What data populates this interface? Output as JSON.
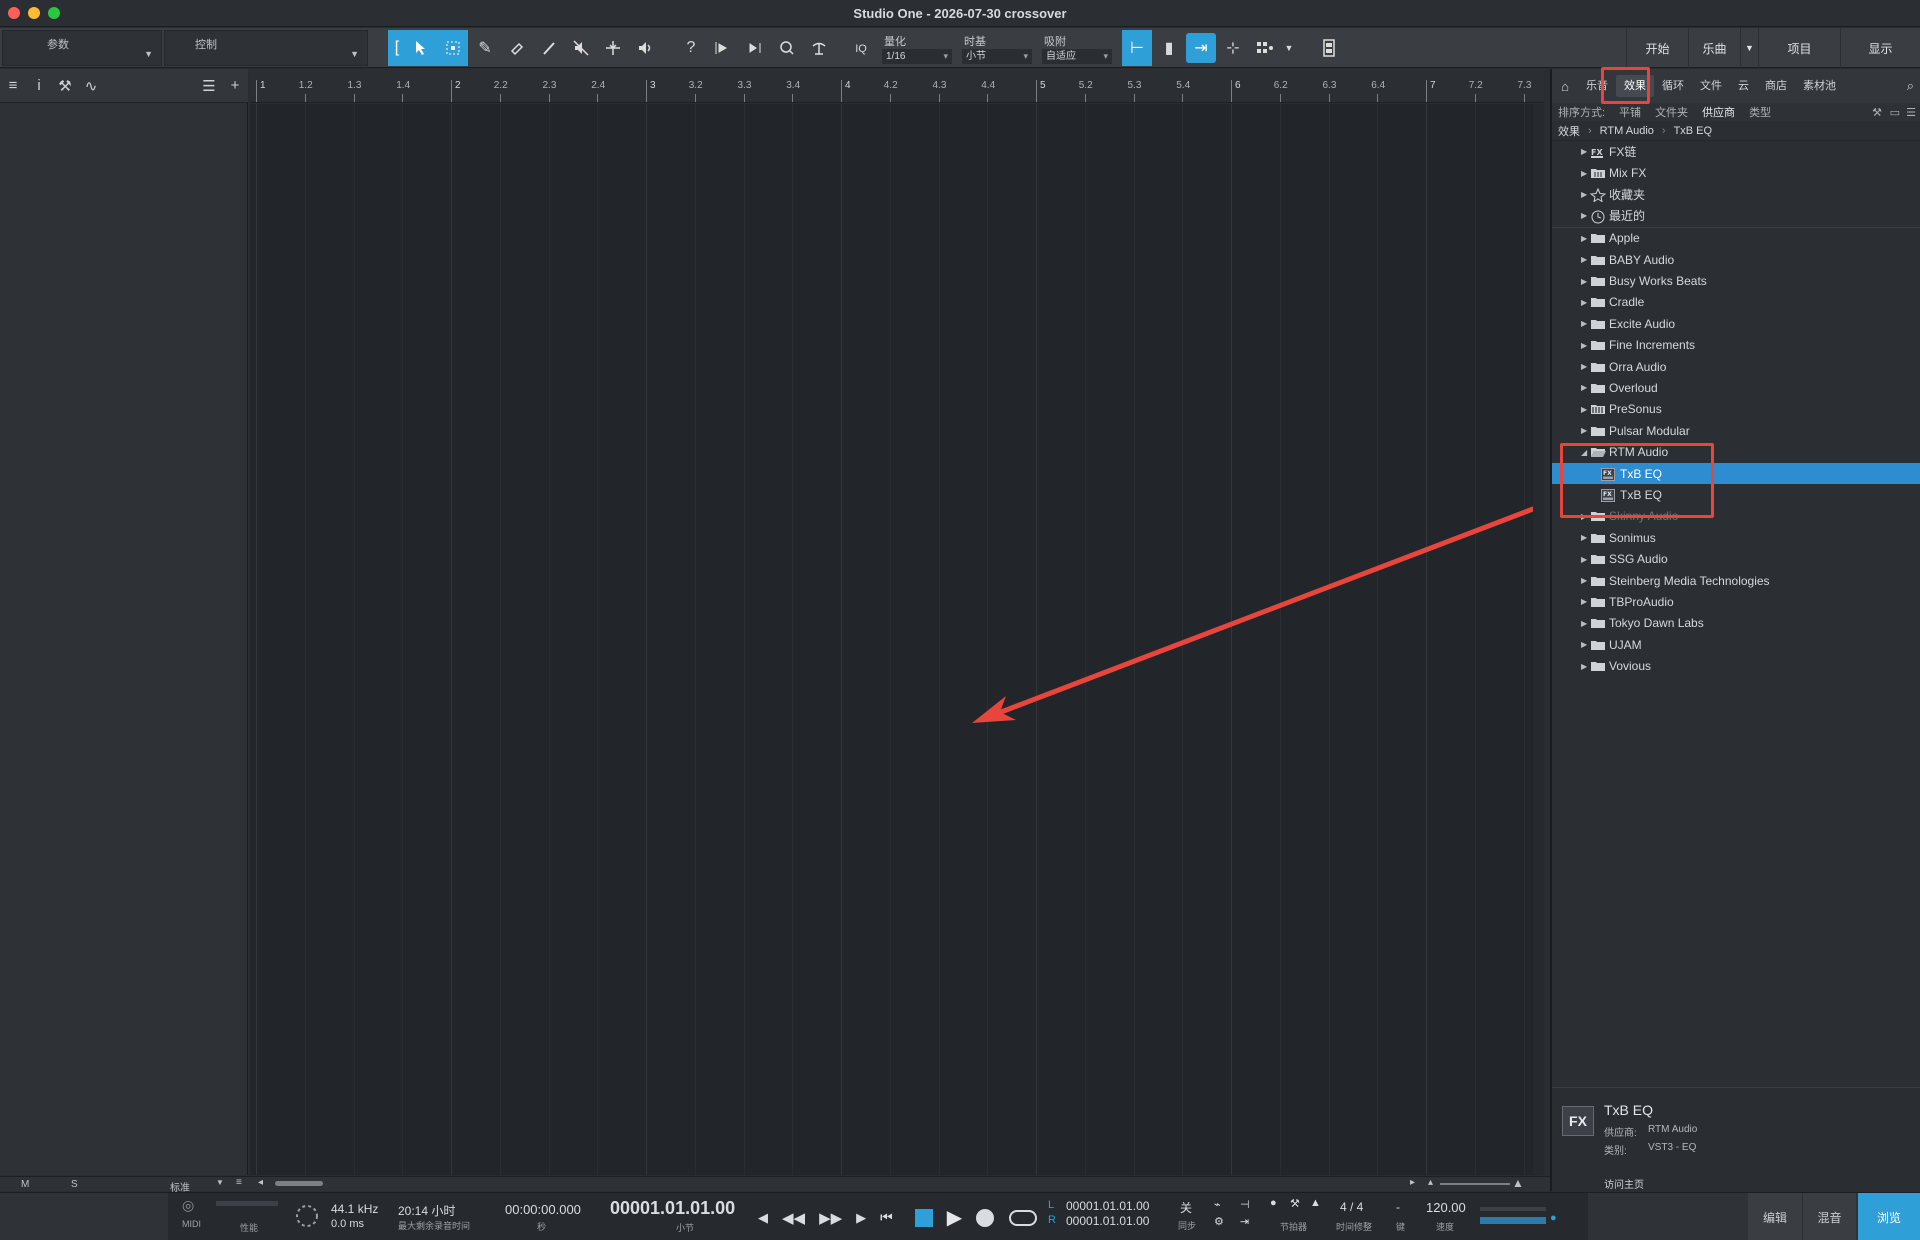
{
  "window": {
    "title": "Studio One - 2026-07-30 crossover"
  },
  "toolbar": {
    "param_label": "参数",
    "control_label": "控制",
    "quantize": {
      "label": "量化",
      "value": "1/16"
    },
    "timebase": {
      "label": "时基",
      "value": "小节"
    },
    "snap": {
      "label": "吸附",
      "value": "自适应"
    },
    "iq_label": "IQ",
    "help_glyph": "?",
    "nav": {
      "start": "开始",
      "song": "乐曲",
      "project": "项目",
      "show": "显示"
    }
  },
  "ruler": {
    "labels": [
      "1",
      "1.2",
      "1.3",
      "1.4",
      "2",
      "2.2",
      "2.3",
      "2.4",
      "3",
      "3.2",
      "3.3",
      "3.4",
      "4",
      "4.2",
      "4.3",
      "4.4",
      "5",
      "5.2",
      "5.3",
      "5.4",
      "6",
      "6.2",
      "6.3",
      "6.4",
      "7",
      "7.2",
      "7.3"
    ]
  },
  "browser": {
    "tabs": [
      "乐音",
      "效果",
      "循环",
      "文件",
      "云",
      "商店",
      "素材池"
    ],
    "active_tab": "效果",
    "sort": {
      "label": "排序方式:",
      "options": [
        "平铺",
        "文件夹",
        "供应商",
        "类型"
      ]
    },
    "breadcrumb": [
      "效果",
      "RTM Audio",
      "TxB EQ"
    ],
    "items": [
      {
        "name": "FX链",
        "icon": "fx-chain-icon"
      },
      {
        "name": "Mix FX",
        "icon": "mix-fx-icon"
      },
      {
        "name": "收藏夹",
        "icon": "star-icon"
      },
      {
        "name": "最近的",
        "icon": "clock-icon"
      },
      {
        "name": "Apple",
        "icon": "folder-icon"
      },
      {
        "name": "BABY Audio",
        "icon": "folder-icon"
      },
      {
        "name": "Busy Works Beats",
        "icon": "folder-icon"
      },
      {
        "name": "Cradle",
        "icon": "folder-icon"
      },
      {
        "name": "Excite Audio",
        "icon": "folder-icon"
      },
      {
        "name": "Fine Increments",
        "icon": "folder-icon"
      },
      {
        "name": "Orra Audio",
        "icon": "folder-icon"
      },
      {
        "name": "Overloud",
        "icon": "folder-icon"
      },
      {
        "name": "PreSonus",
        "icon": "presonus-icon"
      },
      {
        "name": "Pulsar Modular",
        "icon": "folder-icon"
      },
      {
        "name": "RTM Audio",
        "icon": "folder-open-icon"
      },
      {
        "name": "TxB EQ",
        "icon": "fx-plugin-icon"
      },
      {
        "name": "TxB EQ",
        "icon": "fx-plugin-icon"
      },
      {
        "name": "Skinny Audio",
        "icon": "folder-icon"
      },
      {
        "name": "Sonimus",
        "icon": "folder-icon"
      },
      {
        "name": "SSG Audio",
        "icon": "folder-icon"
      },
      {
        "name": "Steinberg Media Technologies",
        "icon": "folder-icon"
      },
      {
        "name": "TBProAudio",
        "icon": "folder-icon"
      },
      {
        "name": "Tokyo Dawn Labs",
        "icon": "folder-icon"
      },
      {
        "name": "UJAM",
        "icon": "folder-icon"
      },
      {
        "name": "Vovious",
        "icon": "folder-icon"
      }
    ],
    "info": {
      "name": "TxB EQ",
      "vendor_label": "供应商:",
      "vendor": "RTM Audio",
      "category_label": "类别:",
      "category": "VST3 - EQ",
      "home_link": "访问主页",
      "badge": "FX"
    }
  },
  "bottom_small": {
    "m": "M",
    "s": "S",
    "preset": "标准"
  },
  "transport": {
    "midi": "MIDI",
    "perf": "性能",
    "sample_rate": "44.1 kHz",
    "latency": "0.0 ms",
    "record_time": "20:14 小时",
    "record_time_label": "最大剩余录音时间",
    "seconds": "00:00:00.000",
    "seconds_label": "秒",
    "bars": "00001.01.01.00",
    "bars_label": "小节",
    "loop_l_tag": "L",
    "loop_r_tag": "R",
    "loop_l": "00001.01.01.00",
    "loop_r": "00001.01.01.00",
    "sync_value": "关",
    "sync_label": "同步",
    "metronome_label": "节拍器",
    "timesig": "4 / 4",
    "timesig_label": "时间修整",
    "key_value": "-",
    "key_label": "键",
    "tempo": "120.00",
    "tempo_label": "速度",
    "views": {
      "edit": "编辑",
      "mix": "混音",
      "browse": "浏览"
    }
  },
  "colors": {
    "accent": "#2f9fd8",
    "selected_row": "#2e8dd1",
    "annotation": "#e8453c"
  }
}
